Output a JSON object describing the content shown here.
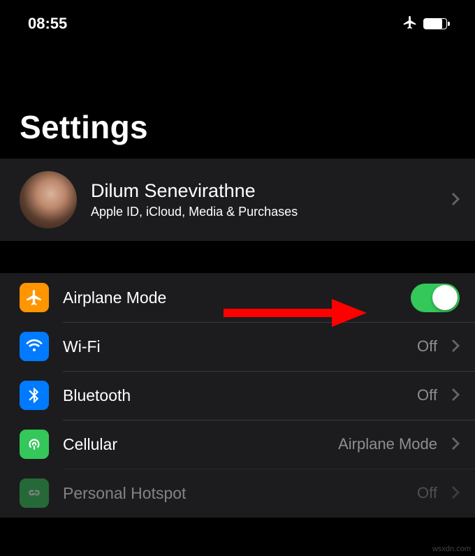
{
  "status": {
    "time": "08:55"
  },
  "header": {
    "title": "Settings"
  },
  "profile": {
    "name": "Dilum Senevirathne",
    "subtitle": "Apple ID, iCloud, Media & Purchases"
  },
  "settings": {
    "airplane": {
      "label": "Airplane Mode",
      "enabled": true
    },
    "wifi": {
      "label": "Wi-Fi",
      "value": "Off"
    },
    "bluetooth": {
      "label": "Bluetooth",
      "value": "Off"
    },
    "cellular": {
      "label": "Cellular",
      "value": "Airplane Mode"
    },
    "hotspot": {
      "label": "Personal Hotspot",
      "value": "Off"
    }
  },
  "watermark": "wsxdn.com"
}
